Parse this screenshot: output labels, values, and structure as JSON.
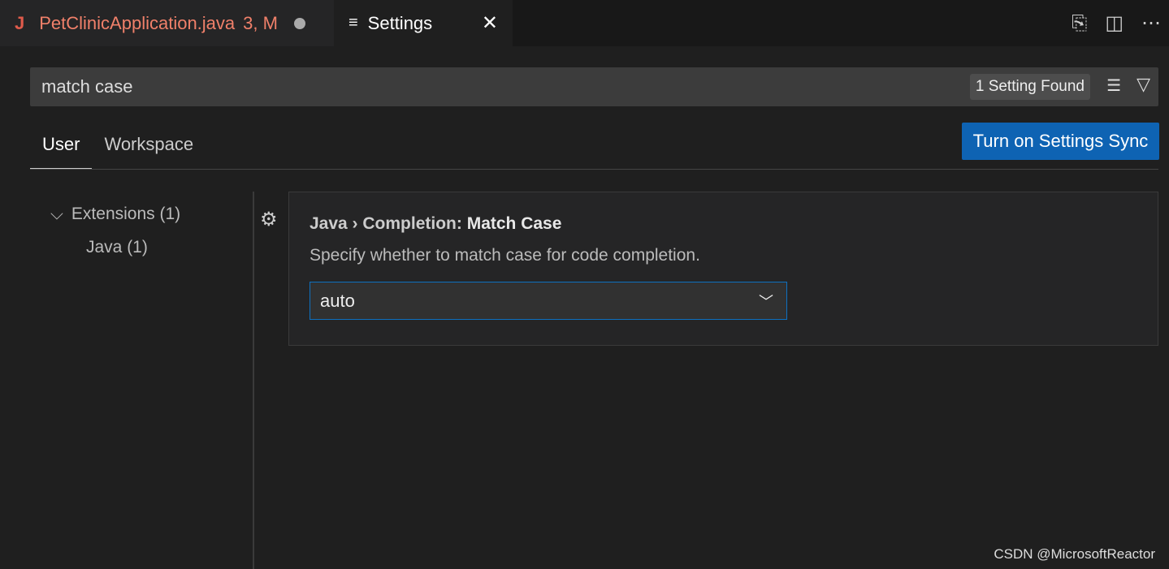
{
  "tabs": [
    {
      "icon": "J",
      "label": "PetClinicApplication.java",
      "status": "3, M",
      "modified": true
    },
    {
      "label": "Settings"
    }
  ],
  "search": {
    "value": "match case",
    "found": "1 Setting Found"
  },
  "scope_tabs": [
    "User",
    "Workspace"
  ],
  "sync_button": "Turn on Settings Sync",
  "tree": [
    {
      "label": "Extensions (1)"
    },
    {
      "label": "Java (1)"
    }
  ],
  "setting": {
    "category": "Java › Completion: ",
    "name": "Match Case",
    "description": "Specify whether to match case for code completion.",
    "value": "auto"
  },
  "watermark": "CSDN @MicrosoftReactor",
  "colors": {
    "accent": "#0e63b3",
    "tab_error": "#f0806a"
  }
}
